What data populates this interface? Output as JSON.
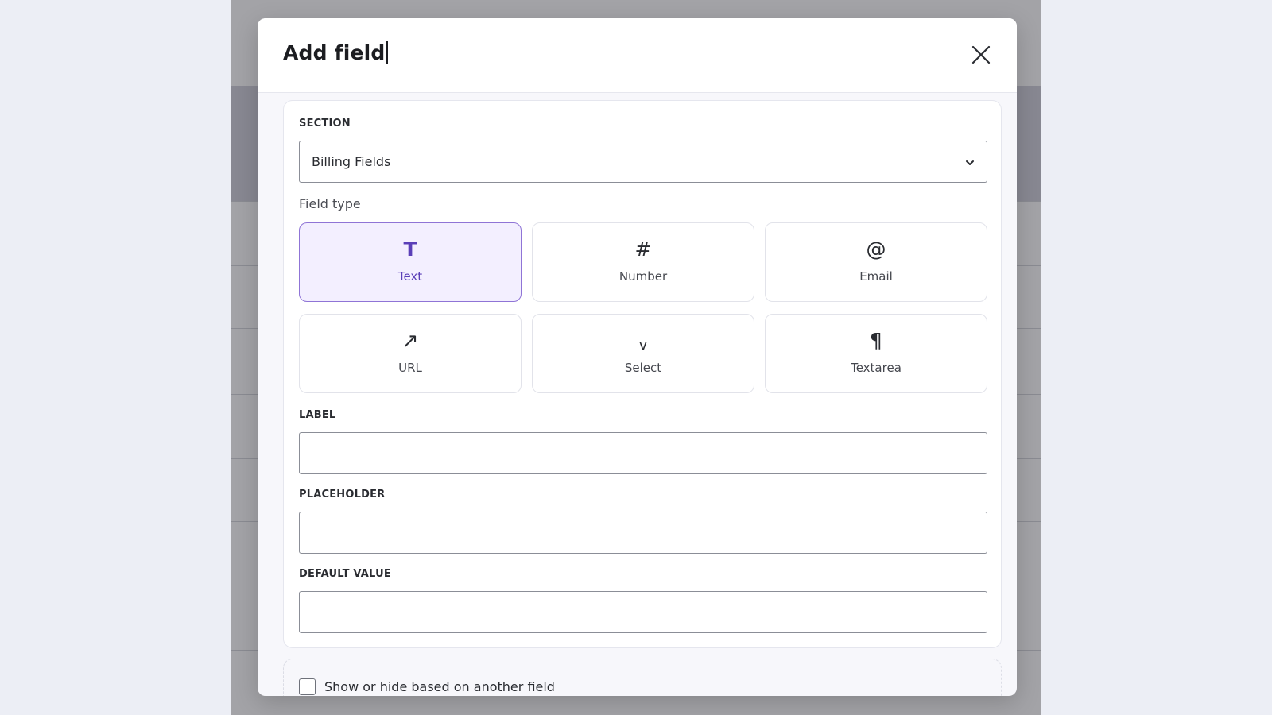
{
  "modal": {
    "title": "Add field",
    "close_icon": "close-icon"
  },
  "section": {
    "label": "SECTION",
    "selected": "Billing Fields",
    "chevron_icon": "chevron-down-icon"
  },
  "field_type": {
    "label": "Field type",
    "selected": "Text",
    "options": [
      {
        "icon": "T",
        "label": "Text",
        "selected": true
      },
      {
        "icon": "#",
        "label": "Number",
        "selected": false
      },
      {
        "icon": "@",
        "label": "Email",
        "selected": false
      },
      {
        "icon": "↗",
        "label": "URL",
        "selected": false
      },
      {
        "icon": "v",
        "label": "Select",
        "selected": false
      },
      {
        "icon": "¶",
        "label": "Textarea",
        "selected": false
      }
    ]
  },
  "label_field": {
    "label": "LABEL",
    "value": ""
  },
  "placeholder_field": {
    "label": "PLACEHOLDER",
    "value": ""
  },
  "default_value_field": {
    "label": "DEFAULT VALUE",
    "value": ""
  },
  "conditional": {
    "label": "Show or hide based on another field",
    "checked": false
  },
  "colors": {
    "accent": "#5a3fb8",
    "accent_bg": "#f3efff",
    "accent_border": "#8f74d6"
  }
}
